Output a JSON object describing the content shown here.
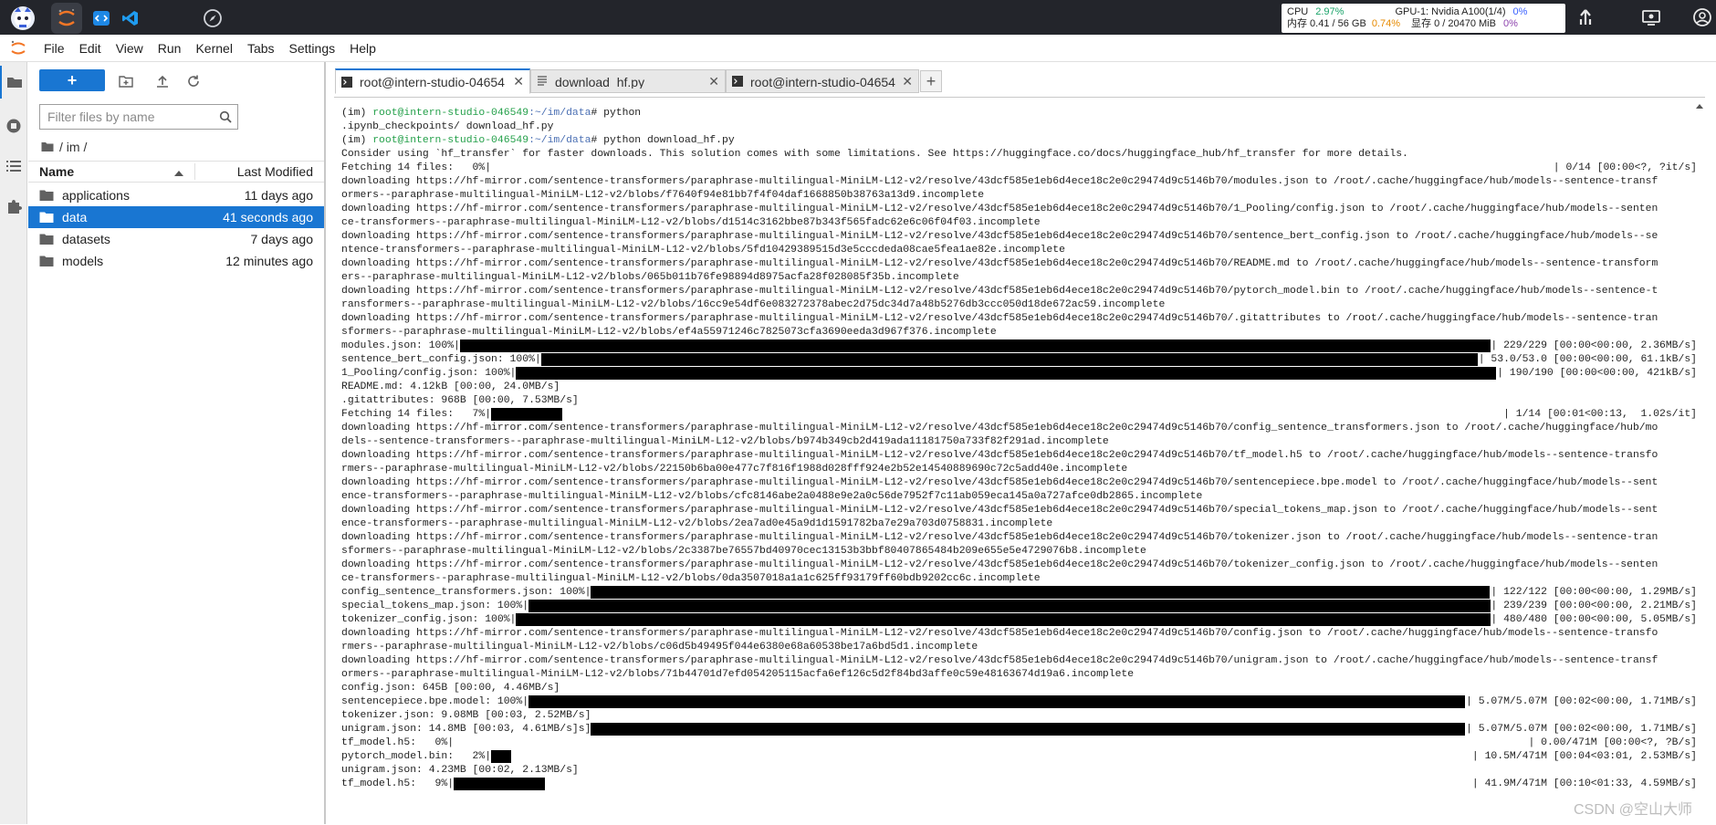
{
  "topbar": {
    "apps": [
      {
        "icon": "mascot-avatar-icon"
      },
      {
        "icon": "jupyter-icon"
      },
      {
        "icon": "code-editor-icon"
      },
      {
        "icon": "vscode-icon"
      },
      {
        "icon": "compass-icon"
      }
    ],
    "stats": {
      "cpu_label": "CPU",
      "cpu_value": "2.97%",
      "gpu_label": "GPU-1: Nvidia A100(1/4)",
      "gpu_value": "0%",
      "mem_label": "内存 0.41 / 56 GB",
      "mem_value": "0.74%",
      "vram_label": "显存 0 / 20470 MiB",
      "vram_value": "0%"
    }
  },
  "menubar": {
    "items": [
      "File",
      "Edit",
      "View",
      "Run",
      "Kernel",
      "Tabs",
      "Settings",
      "Help"
    ]
  },
  "filebrowser": {
    "new_label": "+",
    "filter_placeholder": "Filter files by name",
    "breadcrumb": "/ im /",
    "col_name": "Name",
    "col_modified": "Last Modified",
    "rows": [
      {
        "name": "applications",
        "modified": "11 days ago",
        "selected": false
      },
      {
        "name": "data",
        "modified": "41 seconds ago",
        "selected": true
      },
      {
        "name": "datasets",
        "modified": "7 days ago",
        "selected": false
      },
      {
        "name": "models",
        "modified": "12 minutes ago",
        "selected": false
      }
    ]
  },
  "tabs": [
    {
      "label": "root@intern-studio-04654",
      "icon": "terminal-icon",
      "active": true
    },
    {
      "label": "download_hf.py",
      "icon": "file-icon",
      "active": false
    },
    {
      "label": "root@intern-studio-04654",
      "icon": "terminal-icon",
      "active": false
    }
  ],
  "terminal": {
    "lines": [
      {
        "t": "prompt",
        "user": "root@intern-studio-046549",
        "path": ":~/im/data",
        "cmd": "# python"
      },
      {
        "t": "text",
        "s": ".ipynb_checkpoints/ download_hf.py"
      },
      {
        "t": "prompt",
        "user": "root@intern-studio-046549",
        "path": ":~/im/data",
        "cmd": "# python download_hf.py"
      },
      {
        "t": "text",
        "s": "Consider using `hf_transfer` for faster downloads. This solution comes with some limitations. See https://huggingface.co/docs/huggingface_hub/hf_transfer for more details."
      },
      {
        "t": "bar",
        "pre": "Fetching 14 files:   0%|",
        "fill": 0.0,
        "post": "| 0/14 [00:00<?, ?it/s]"
      },
      {
        "t": "text",
        "s": "downloading https://hf-mirror.com/sentence-transformers/paraphrase-multilingual-MiniLM-L12-v2/resolve/43dcf585e1eb6d4ece18c2e0c29474d9c5146b70/modules.json to /root/.cache/huggingface/hub/models--sentence-transf"
      },
      {
        "t": "text",
        "s": "ormers--paraphrase-multilingual-MiniLM-L12-v2/blobs/f7640f94e81bb7f4f04daf1668850b38763a13d9.incomplete"
      },
      {
        "t": "text",
        "s": "downloading https://hf-mirror.com/sentence-transformers/paraphrase-multilingual-MiniLM-L12-v2/resolve/43dcf585e1eb6d4ece18c2e0c29474d9c5146b70/1_Pooling/config.json to /root/.cache/huggingface/hub/models--senten"
      },
      {
        "t": "text",
        "s": "ce-transformers--paraphrase-multilingual-MiniLM-L12-v2/blobs/d1514c3162bbe87b343f565fadc62e6c06f04f03.incomplete"
      },
      {
        "t": "text",
        "s": "downloading https://hf-mirror.com/sentence-transformers/paraphrase-multilingual-MiniLM-L12-v2/resolve/43dcf585e1eb6d4ece18c2e0c29474d9c5146b70/sentence_bert_config.json to /root/.cache/huggingface/hub/models--se"
      },
      {
        "t": "text",
        "s": "ntence-transformers--paraphrase-multilingual-MiniLM-L12-v2/blobs/5fd10429389515d3e5cccdeda08cae5fea1ae82e.incomplete"
      },
      {
        "t": "text",
        "s": "downloading https://hf-mirror.com/sentence-transformers/paraphrase-multilingual-MiniLM-L12-v2/resolve/43dcf585e1eb6d4ece18c2e0c29474d9c5146b70/README.md to /root/.cache/huggingface/hub/models--sentence-transform"
      },
      {
        "t": "text",
        "s": "ers--paraphrase-multilingual-MiniLM-L12-v2/blobs/065b011b76fe98894d8975acfa28f028085f35b.incomplete"
      },
      {
        "t": "text",
        "s": "downloading https://hf-mirror.com/sentence-transformers/paraphrase-multilingual-MiniLM-L12-v2/resolve/43dcf585e1eb6d4ece18c2e0c29474d9c5146b70/pytorch_model.bin to /root/.cache/huggingface/hub/models--sentence-t"
      },
      {
        "t": "text",
        "s": "ransformers--paraphrase-multilingual-MiniLM-L12-v2/blobs/16cc9e54df6e083272378abec2d75dc34d7a48b5276db3ccc050d18de672ac59.incomplete"
      },
      {
        "t": "text",
        "s": "downloading https://hf-mirror.com/sentence-transformers/paraphrase-multilingual-MiniLM-L12-v2/resolve/43dcf585e1eb6d4ece18c2e0c29474d9c5146b70/.gitattributes to /root/.cache/huggingface/hub/models--sentence-tran"
      },
      {
        "t": "text",
        "s": "sformers--paraphrase-multilingual-MiniLM-L12-v2/blobs/ef4a55971246c7825073cfa3690eeda3d967f376.incomplete"
      },
      {
        "t": "bar",
        "pre": "modules.json: 100%|",
        "fill": 1.0,
        "post": "| 229/229 [00:00<00:00, 2.36MB/s]"
      },
      {
        "t": "bar",
        "pre": "sentence_bert_config.json: 100%|",
        "fill": 1.0,
        "post": "| 53.0/53.0 [00:00<00:00, 61.1kB/s]"
      },
      {
        "t": "bar",
        "pre": "1_Pooling/config.json: 100%|",
        "fill": 1.0,
        "post": "| 190/190 [00:00<00:00, 421kB/s]"
      },
      {
        "t": "text",
        "s": "README.md: 4.12kB [00:00, 24.0MB/s]"
      },
      {
        "t": "text",
        "s": ".gitattributes: 968B [00:00, 7.53MB/s]"
      },
      {
        "t": "bar",
        "pre": "Fetching 14 files:   7%|",
        "fill": 0.07,
        "post": "| 1/14 [00:01<00:13,  1.02s/it]"
      },
      {
        "t": "text",
        "s": "downloading https://hf-mirror.com/sentence-transformers/paraphrase-multilingual-MiniLM-L12-v2/resolve/43dcf585e1eb6d4ece18c2e0c29474d9c5146b70/config_sentence_transformers.json to /root/.cache/huggingface/hub/mo"
      },
      {
        "t": "text",
        "s": "dels--sentence-transformers--paraphrase-multilingual-MiniLM-L12-v2/blobs/b974b349cb2d419ada11181750a733f82f291ad.incomplete"
      },
      {
        "t": "text",
        "s": "downloading https://hf-mirror.com/sentence-transformers/paraphrase-multilingual-MiniLM-L12-v2/resolve/43dcf585e1eb6d4ece18c2e0c29474d9c5146b70/tf_model.h5 to /root/.cache/huggingface/hub/models--sentence-transfo"
      },
      {
        "t": "text",
        "s": "rmers--paraphrase-multilingual-MiniLM-L12-v2/blobs/22150b6ba00e477c7f816f1988d028fff924e2b52e14540889690c72c5add40e.incomplete"
      },
      {
        "t": "text",
        "s": "downloading https://hf-mirror.com/sentence-transformers/paraphrase-multilingual-MiniLM-L12-v2/resolve/43dcf585e1eb6d4ece18c2e0c29474d9c5146b70/sentencepiece.bpe.model to /root/.cache/huggingface/hub/models--sent"
      },
      {
        "t": "text",
        "s": "ence-transformers--paraphrase-multilingual-MiniLM-L12-v2/blobs/cfc8146abe2a0488e9e2a0c56de7952f7c11ab059eca145a0a727afce0db2865.incomplete"
      },
      {
        "t": "text",
        "s": "downloading https://hf-mirror.com/sentence-transformers/paraphrase-multilingual-MiniLM-L12-v2/resolve/43dcf585e1eb6d4ece18c2e0c29474d9c5146b70/special_tokens_map.json to /root/.cache/huggingface/hub/models--sent"
      },
      {
        "t": "text",
        "s": "ence-transformers--paraphrase-multilingual-MiniLM-L12-v2/blobs/2ea7ad0e45a9d1d1591782ba7e29a703d0758831.incomplete"
      },
      {
        "t": "text",
        "s": "downloading https://hf-mirror.com/sentence-transformers/paraphrase-multilingual-MiniLM-L12-v2/resolve/43dcf585e1eb6d4ece18c2e0c29474d9c5146b70/tokenizer.json to /root/.cache/huggingface/hub/models--sentence-tran"
      },
      {
        "t": "text",
        "s": "sformers--paraphrase-multilingual-MiniLM-L12-v2/blobs/2c3387be76557bd40970cec13153b3bbf80407865484b209e655e5e4729076b8.incomplete"
      },
      {
        "t": "text",
        "s": "downloading https://hf-mirror.com/sentence-transformers/paraphrase-multilingual-MiniLM-L12-v2/resolve/43dcf585e1eb6d4ece18c2e0c29474d9c5146b70/tokenizer_config.json to /root/.cache/huggingface/hub/models--senten"
      },
      {
        "t": "text",
        "s": "ce-transformers--paraphrase-multilingual-MiniLM-L12-v2/blobs/0da3507018a1a1c625ff93179ff60bdb9202cc6c.incomplete"
      },
      {
        "t": "bar",
        "pre": "config_sentence_transformers.json: 100%|",
        "fill": 1.0,
        "post": "| 122/122 [00:00<00:00, 1.29MB/s]"
      },
      {
        "t": "bar",
        "pre": "special_tokens_map.json: 100%|",
        "fill": 1.0,
        "post": "| 239/239 [00:00<00:00, 2.21MB/s]"
      },
      {
        "t": "bar",
        "pre": "tokenizer_config.json: 100%|",
        "fill": 1.0,
        "post": "| 480/480 [00:00<00:00, 5.05MB/s]"
      },
      {
        "t": "text",
        "s": "downloading https://hf-mirror.com/sentence-transformers/paraphrase-multilingual-MiniLM-L12-v2/resolve/43dcf585e1eb6d4ece18c2e0c29474d9c5146b70/config.json to /root/.cache/huggingface/hub/models--sentence-transfo"
      },
      {
        "t": "text",
        "s": "rmers--paraphrase-multilingual-MiniLM-L12-v2/blobs/c06d5b49495f044e6380e68a60538be17a6bd5d1.incomplete"
      },
      {
        "t": "text",
        "s": "downloading https://hf-mirror.com/sentence-transformers/paraphrase-multilingual-MiniLM-L12-v2/resolve/43dcf585e1eb6d4ece18c2e0c29474d9c5146b70/unigram.json to /root/.cache/huggingface/hub/models--sentence-transf"
      },
      {
        "t": "text",
        "s": "ormers--paraphrase-multilingual-MiniLM-L12-v2/blobs/71b44701d7efd054205115acfa6ef126c5d2f84bd3affe0c59e48163674d19a6.incomplete"
      },
      {
        "t": "text",
        "s": "config.json: 645B [00:00, 4.46MB/s]"
      },
      {
        "t": "bar",
        "pre": "sentencepiece.bpe.model: 100%|",
        "fill": 1.0,
        "post": "| 5.07M/5.07M [00:02<00:00, 1.71MB/s]"
      },
      {
        "t": "text",
        "s": "tokenizer.json: 9.08MB [00:03, 2.52MB/s]"
      },
      {
        "t": "bar",
        "pre": "unigram.json: 14.8MB [00:03, 4.61MB/s]s]",
        "fill": 1.0,
        "post": "| 5.07M/5.07M [00:02<00:00, 1.71MB/s]"
      },
      {
        "t": "bar",
        "pre": "tf_model.h5:   0%|",
        "fill": 0.0,
        "post": "| 0.00/471M [00:00<?, ?B/s]"
      },
      {
        "t": "bar",
        "pre": "pytorch_model.bin:   2%|",
        "fill": 0.02,
        "post": "| 10.5M/471M [00:04<03:01, 2.53MB/s]"
      },
      {
        "t": "text",
        "s": "unigram.json: 4.23MB [00:02, 2.13MB/s]"
      },
      {
        "t": "bar",
        "pre": "tf_model.h5:   9%|",
        "fill": 0.09,
        "post": "| 41.9M/471M [00:10<01:33, 4.59MB/s]"
      }
    ]
  },
  "watermark": "CSDN @空山大师"
}
